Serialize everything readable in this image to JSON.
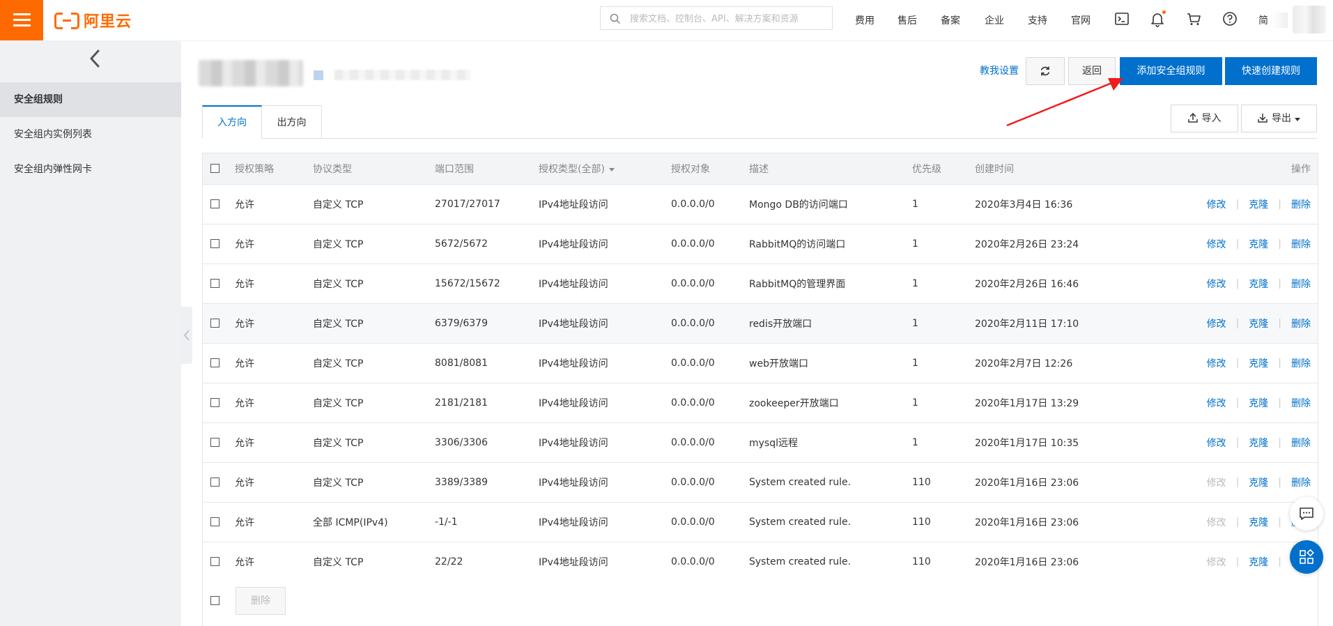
{
  "brand": {
    "logo_text": "阿里云",
    "accent": "#ff6a00",
    "primary": "#0070cc"
  },
  "topbar": {
    "search_placeholder": "搜索文档、控制台、API、解决方案和资源",
    "nav": [
      "费用",
      "售后",
      "备案",
      "企业",
      "支持",
      "官网"
    ],
    "lang": "简",
    "icons": [
      "terminal-icon",
      "bell-icon",
      "cart-icon",
      "help-icon"
    ]
  },
  "sidebar": {
    "items": [
      {
        "label": "安全组规则",
        "active": true
      },
      {
        "label": "安全组内实例列表",
        "active": false
      },
      {
        "label": "安全组内弹性网卡",
        "active": false
      }
    ]
  },
  "header": {
    "help_link": "教我设置",
    "back_button": "返回",
    "add_rule_button": "添加安全组规则",
    "quick_create_button": "快速创建规则"
  },
  "tabs": [
    {
      "label": "入方向",
      "active": true
    },
    {
      "label": "出方向",
      "active": false
    }
  ],
  "actions": {
    "import": "导入",
    "export": "导出"
  },
  "table": {
    "columns": [
      "授权策略",
      "协议类型",
      "端口范围",
      "授权类型(全部)",
      "授权对象",
      "描述",
      "优先级",
      "创建时间",
      "操作"
    ],
    "rows": [
      {
        "policy": "允许",
        "protocol": "自定义 TCP",
        "ports": "27017/27017",
        "auth_type": "IPv4地址段访问",
        "target": "0.0.0.0/0",
        "desc": "Mongo DB的访问端口",
        "priority": "1",
        "created": "2020年3月4日 16:36",
        "edit_enabled": true
      },
      {
        "policy": "允许",
        "protocol": "自定义 TCP",
        "ports": "5672/5672",
        "auth_type": "IPv4地址段访问",
        "target": "0.0.0.0/0",
        "desc": "RabbitMQ的访问端口",
        "priority": "1",
        "created": "2020年2月26日 23:24",
        "edit_enabled": true
      },
      {
        "policy": "允许",
        "protocol": "自定义 TCP",
        "ports": "15672/15672",
        "auth_type": "IPv4地址段访问",
        "target": "0.0.0.0/0",
        "desc": "RabbitMQ的管理界面",
        "priority": "1",
        "created": "2020年2月26日 16:46",
        "edit_enabled": true
      },
      {
        "policy": "允许",
        "protocol": "自定义 TCP",
        "ports": "6379/6379",
        "auth_type": "IPv4地址段访问",
        "target": "0.0.0.0/0",
        "desc": "redis开放端口",
        "priority": "1",
        "created": "2020年2月11日 17:10",
        "edit_enabled": true,
        "highlight": true
      },
      {
        "policy": "允许",
        "protocol": "自定义 TCP",
        "ports": "8081/8081",
        "auth_type": "IPv4地址段访问",
        "target": "0.0.0.0/0",
        "desc": "web开放端口",
        "priority": "1",
        "created": "2020年2月7日 12:26",
        "edit_enabled": true
      },
      {
        "policy": "允许",
        "protocol": "自定义 TCP",
        "ports": "2181/2181",
        "auth_type": "IPv4地址段访问",
        "target": "0.0.0.0/0",
        "desc": "zookeeper开放端口",
        "priority": "1",
        "created": "2020年1月17日 13:29",
        "edit_enabled": true
      },
      {
        "policy": "允许",
        "protocol": "自定义 TCP",
        "ports": "3306/3306",
        "auth_type": "IPv4地址段访问",
        "target": "0.0.0.0/0",
        "desc": "mysql远程",
        "priority": "1",
        "created": "2020年1月17日 10:35",
        "edit_enabled": true
      },
      {
        "policy": "允许",
        "protocol": "自定义 TCP",
        "ports": "3389/3389",
        "auth_type": "IPv4地址段访问",
        "target": "0.0.0.0/0",
        "desc": "System created rule.",
        "priority": "110",
        "created": "2020年1月16日 23:06",
        "edit_enabled": false
      },
      {
        "policy": "允许",
        "protocol": "全部 ICMP(IPv4)",
        "ports": "-1/-1",
        "auth_type": "IPv4地址段访问",
        "target": "0.0.0.0/0",
        "desc": "System created rule.",
        "priority": "110",
        "created": "2020年1月16日 23:06",
        "edit_enabled": false
      },
      {
        "policy": "允许",
        "protocol": "自定义 TCP",
        "ports": "22/22",
        "auth_type": "IPv4地址段访问",
        "target": "0.0.0.0/0",
        "desc": "System created rule.",
        "priority": "110",
        "created": "2020年1月16日 23:06",
        "edit_enabled": false
      }
    ],
    "row_actions": {
      "edit": "修改",
      "clone": "克隆",
      "delete": "删除"
    },
    "bulk_delete": "删除"
  }
}
